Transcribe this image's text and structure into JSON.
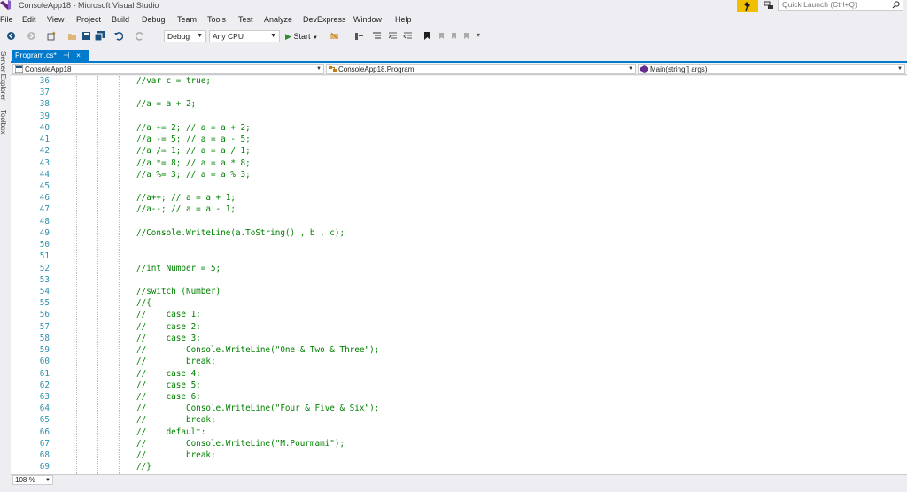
{
  "window": {
    "title": "ConsoleApp18 - Microsoft Visual Studio",
    "quick_launch_placeholder": "Quick Launch (Ctrl+Q)"
  },
  "menu": [
    "File",
    "Edit",
    "View",
    "Project",
    "Build",
    "Debug",
    "Team",
    "Tools",
    "Test",
    "Analyze",
    "DevExpress",
    "Window",
    "Help"
  ],
  "toolbar": {
    "configuration": "Debug",
    "platform": "Any CPU",
    "start_label": "Start"
  },
  "side_tabs": [
    "Server Explorer",
    "Toolbox"
  ],
  "document_tab": {
    "name": "Program.cs*",
    "pin_glyph": "⊣",
    "close_glyph": "×"
  },
  "navigation": {
    "project": "ConsoleApp18",
    "type": "ConsoleApp18.Program",
    "member": "Main(string[] args)"
  },
  "code": {
    "lines": [
      {
        "n": "36",
        "text": "//var c = true;"
      },
      {
        "n": "37",
        "text": ""
      },
      {
        "n": "38",
        "text": "//a = a + 2;"
      },
      {
        "n": "39",
        "text": ""
      },
      {
        "n": "40",
        "text": "//a += 2; // a = a + 2;"
      },
      {
        "n": "41",
        "text": "//a -= 5; // a = a - 5;"
      },
      {
        "n": "42",
        "text": "//a /= 1; // a = a / 1;"
      },
      {
        "n": "43",
        "text": "//a *= 8; // a = a * 8;"
      },
      {
        "n": "44",
        "text": "//a %= 3; // a = a % 3;"
      },
      {
        "n": "45",
        "text": ""
      },
      {
        "n": "46",
        "text": "//a++; // a = a + 1;"
      },
      {
        "n": "47",
        "text": "//a--; // a = a - 1;"
      },
      {
        "n": "48",
        "text": ""
      },
      {
        "n": "49",
        "text": "//Console.WriteLine(a.ToString() , b , c);"
      },
      {
        "n": "50",
        "text": ""
      },
      {
        "n": "51",
        "text": ""
      },
      {
        "n": "52",
        "text": "//int Number = 5;"
      },
      {
        "n": "53",
        "text": ""
      },
      {
        "n": "54",
        "text": "//switch (Number)"
      },
      {
        "n": "55",
        "text": "//{"
      },
      {
        "n": "56",
        "text": "//    case 1:"
      },
      {
        "n": "57",
        "text": "//    case 2:"
      },
      {
        "n": "58",
        "text": "//    case 3:"
      },
      {
        "n": "59",
        "text": "//        Console.WriteLine(\"One & Two & Three\");"
      },
      {
        "n": "60",
        "text": "//        break;"
      },
      {
        "n": "61",
        "text": "//    case 4:"
      },
      {
        "n": "62",
        "text": "//    case 5:"
      },
      {
        "n": "63",
        "text": "//    case 6:"
      },
      {
        "n": "64",
        "text": "//        Console.WriteLine(\"Four & Five & Six\");"
      },
      {
        "n": "65",
        "text": "//        break;"
      },
      {
        "n": "66",
        "text": "//    default:"
      },
      {
        "n": "67",
        "text": "//        Console.WriteLine(\"M.Pourmami\");"
      },
      {
        "n": "68",
        "text": "//        break;"
      },
      {
        "n": "69",
        "text": "//}"
      }
    ]
  },
  "zoom": "108 %",
  "colors": {
    "accent": "#007acc",
    "comment": "#008000",
    "line_number": "#2b91af",
    "notify": "#f0c000"
  }
}
